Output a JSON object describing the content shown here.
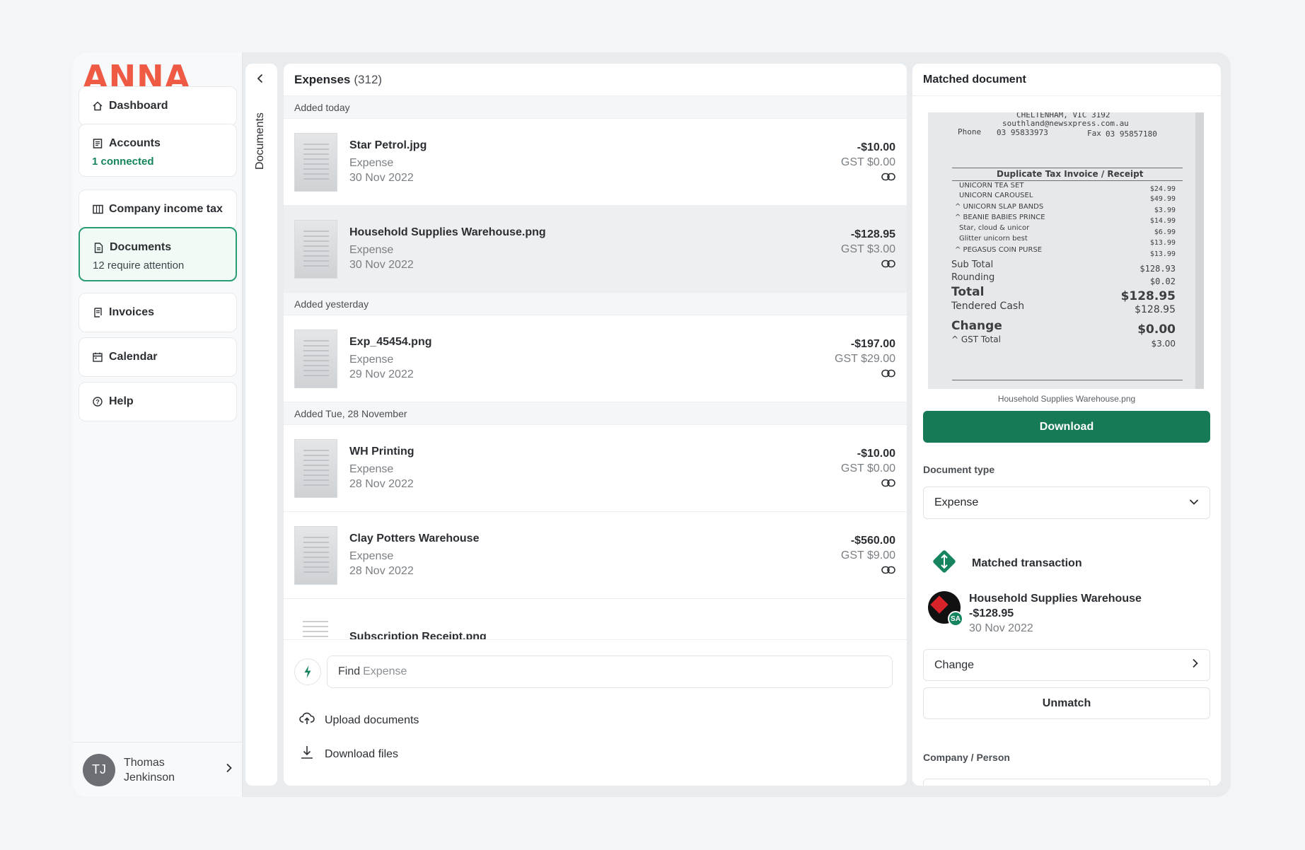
{
  "brand": {
    "logo": "ANNA",
    "color": "#ef5a45"
  },
  "sidebar": {
    "items": [
      {
        "label": "Dashboard",
        "icon": "home-icon"
      },
      {
        "label": "Accounts",
        "sub": "1 connected",
        "icon": "ledger-icon"
      },
      {
        "label": "Company income tax",
        "icon": "building-icon"
      },
      {
        "label": "Documents",
        "sub": "12 require attention",
        "icon": "document-icon"
      },
      {
        "label": "Invoices",
        "icon": "invoice-icon"
      },
      {
        "label": "Calendar",
        "icon": "calendar-icon"
      },
      {
        "label": "Help",
        "icon": "help-icon"
      }
    ],
    "user": {
      "initials": "TJ",
      "name_first": "Thomas",
      "name_last": "Jenkinson"
    }
  },
  "doc_tab": {
    "label": "Documents"
  },
  "expenses": {
    "title": "Expenses",
    "count": "(312)",
    "groups": [
      {
        "label": "Added today",
        "rows": [
          {
            "title": "Star Petrol.jpg",
            "type": "Expense",
            "date": "30 Nov 2022",
            "amount": "-$10.00",
            "gst": "GST $0.00"
          },
          {
            "title": "Household Supplies Warehouse.png",
            "type": "Expense",
            "date": "30 Nov 2022",
            "amount": "-$128.95",
            "gst": "GST $3.00"
          }
        ]
      },
      {
        "label": "Added yesterday",
        "rows": [
          {
            "title": "Exp_45454.png",
            "type": "Expense",
            "date": "29 Nov 2022",
            "amount": "-$197.00",
            "gst": "GST $29.00"
          }
        ]
      },
      {
        "label": "Added Tue, 28 November",
        "rows": [
          {
            "title": "WH Printing",
            "type": "Expense",
            "date": "28 Nov 2022",
            "amount": "-$10.00",
            "gst": "GST $0.00"
          },
          {
            "title": "Clay Potters Warehouse",
            "type": "Expense",
            "date": "28 Nov 2022",
            "amount": "-$560.00",
            "gst": "GST $9.00"
          }
        ]
      }
    ],
    "partial_row": {
      "title": "Subscription Receipt.png"
    },
    "find": {
      "prefix": "Find",
      "placeholder": "Expense"
    },
    "actions": {
      "upload": "Upload documents",
      "download": "Download files"
    }
  },
  "matched": {
    "title": "Matched document",
    "receipt": {
      "header1": "CHELTENHAM, VIC 3192",
      "header2": "southland@newsxpress.com.au",
      "phone_label": "Phone",
      "phone": "03 95833973",
      "fax_label": "Fax",
      "fax": "03 95857180",
      "heading": "Duplicate Tax Invoice / Receipt",
      "items": [
        {
          "name": "UNICORN TEA SET",
          "price": "$24.99"
        },
        {
          "name": "UNICORN CAROUSEL",
          "price": "$49.99"
        },
        {
          "name": "^ UNICORN SLAP BANDS",
          "price": "$3.99"
        },
        {
          "name": "^ BEANIE BABIES PRINCE",
          "price": "$14.99"
        },
        {
          "name": "Star, cloud & unicor",
          "price": "$6.99"
        },
        {
          "name": "Glitter unicorn best",
          "price": "$13.99"
        },
        {
          "name": "^ PEGASUS COIN PURSE",
          "price": "$13.99"
        }
      ],
      "subtotal_label": "Sub Total",
      "subtotal": "$128.93",
      "rounding_label": "Rounding",
      "rounding": "$0.02",
      "total_label": "Total",
      "total": "$128.95",
      "tendered_label": "Tendered Cash",
      "tendered": "$128.95",
      "change_label": "Change",
      "change": "$0.00",
      "gst_label": "^ GST Total",
      "gst": "$3.00"
    },
    "filename": "Household Supplies Warehouse.png",
    "download_label": "Download",
    "doc_type_label": "Document type",
    "doc_type_value": "Expense",
    "matched_tx_label": "Matched transaction",
    "tx": {
      "name": "Household Supplies Warehouse",
      "amount": "-$128.95",
      "date": "30 Nov 2022",
      "badge": "SA"
    },
    "change_label": "Change",
    "unmatch_label": "Unmatch",
    "company_label": "Company / Person",
    "accent": "#167a56"
  }
}
